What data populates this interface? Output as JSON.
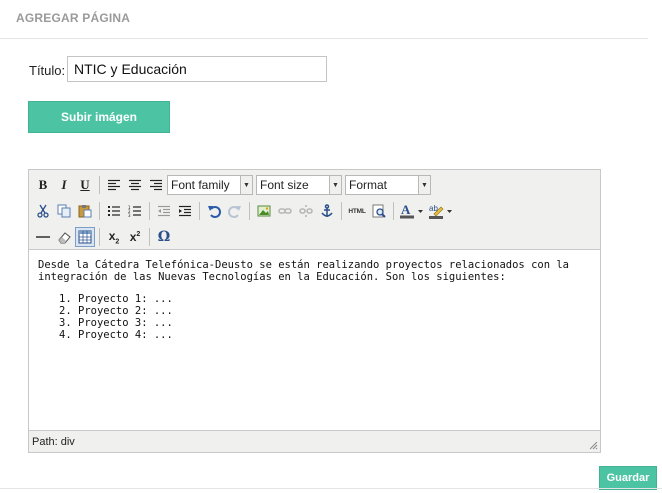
{
  "page": {
    "heading": "AGREGAR PÁGINA"
  },
  "form": {
    "title_label": "Título:",
    "title_value": "NTIC y Educación",
    "upload_button": "Subir imágen",
    "save_button": "Guardar"
  },
  "toolbar": {
    "row1": [
      "bold-icon",
      "italic-icon",
      "underline-icon",
      "align-left-icon",
      "align-center-icon",
      "align-right-icon"
    ],
    "font_family": "Font family",
    "font_size": "Font size",
    "format": "Format",
    "row2": [
      "cut-icon",
      "copy-icon",
      "paste-icon",
      "bullet-list-icon",
      "numbered-list-icon",
      "outdent-icon",
      "indent-icon",
      "undo-icon",
      "redo-icon",
      "insert-image-icon",
      "link-icon",
      "unlink-icon",
      "anchor-icon",
      "html-source-icon",
      "preview-icon",
      "text-color-icon",
      "highlight-color-icon"
    ],
    "html_label": "HTML",
    "row3": [
      "horizontal-rule-icon",
      "eraser-icon",
      "table-icon",
      "subscript-icon",
      "superscript-icon",
      "special-char-icon"
    ]
  },
  "editor": {
    "paragraph": "Desde la Cátedra Telefónica-Deusto se están realizando proyectos relacionados con la integración de las Nuevas Tecnologías en la Educación. Son los siguientes:",
    "items": [
      "Proyecto 1: ...",
      "Proyecto 2: ...",
      "Proyecto 3: ...",
      "Proyecto 4: ..."
    ],
    "path": "Path: div"
  },
  "colors": {
    "accent": "#4cc4a4",
    "heading": "#9a9a9a",
    "toolbar_bg": "#f0f0ee"
  }
}
